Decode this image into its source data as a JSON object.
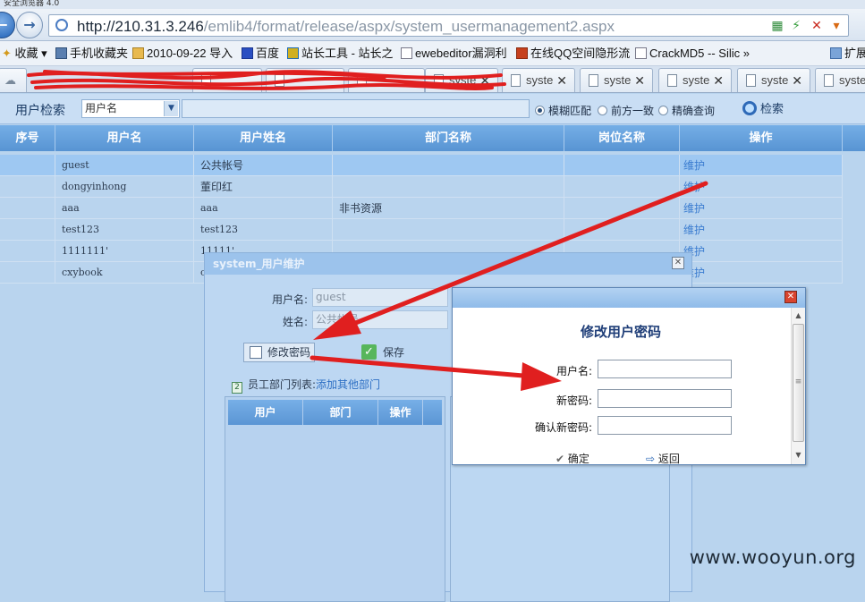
{
  "browser": {
    "title_partial": "安全浏览器 4.0",
    "url_host": "http://210.31.3.246",
    "url_path": "/emlib4/format/release/aspx/system_usermanagement2.aspx",
    "bookmarks": [
      {
        "label": "收藏"
      },
      {
        "label": "手机收藏夹"
      },
      {
        "label": "2010-09-22 导入"
      },
      {
        "label": "百度"
      },
      {
        "label": "站长工具 - 站长之"
      },
      {
        "label": "ewebeditor漏洞利"
      },
      {
        "label": "在线QQ空间隐形流"
      },
      {
        "label": "CrackMD5 -- Silic"
      },
      {
        "label": "扩展"
      }
    ],
    "tabs": [
      {
        "label": "syste"
      },
      {
        "label": "syste"
      },
      {
        "label": "syste"
      },
      {
        "label": "syste"
      },
      {
        "label": "syste"
      },
      {
        "label": "syste"
      }
    ]
  },
  "search": {
    "label": "用户检索",
    "field": "用户名",
    "mode_fuzzy": "模糊匹配",
    "mode_prefix": "前方一致",
    "mode_exact": "精确查询",
    "button": "检索"
  },
  "grid": {
    "columns": [
      "序号",
      "用户名",
      "用户姓名",
      "部门名称",
      "岗位名称",
      "操作"
    ],
    "rows": [
      {
        "username": "guest",
        "name": "公共帐号",
        "dept": "",
        "post": "",
        "action": "维护"
      },
      {
        "username": "dongyinhong",
        "name": "董印红",
        "dept": "",
        "post": "",
        "action": "维护"
      },
      {
        "username": "aaa",
        "name": "aaa",
        "dept": "非书资源",
        "post": "",
        "action": "维护"
      },
      {
        "username": "test123",
        "name": "test123",
        "dept": "",
        "post": "",
        "action": "维护"
      },
      {
        "username": "1111111'",
        "name": "11111'",
        "dept": "",
        "post": "",
        "action": "维护"
      },
      {
        "username": "cxybook",
        "name": "c",
        "dept": "",
        "post": "",
        "action": "维护"
      }
    ]
  },
  "maint_dialog": {
    "title": "system_用户维护",
    "username_label": "用户名:",
    "username_value": "guest",
    "name_label": "姓名:",
    "name_value": "公共帐号",
    "change_password_button": "修改密码",
    "save_button": "保存",
    "dept_list_label": "员工部门列表:",
    "add_dept_link": "添加其他部门",
    "dept_columns": [
      "用户",
      "部门",
      "操作"
    ]
  },
  "pwd_dialog": {
    "heading": "修改用户密码",
    "username_label": "用户名:",
    "new_password_label": "新密码:",
    "confirm_password_label": "确认新密码:",
    "ok_button": "确定",
    "back_button": "返回"
  },
  "watermark": "www.wooyun.org",
  "colors": {
    "header_blue": "#5894d3",
    "selected_row": "#9ec8f2",
    "link": "#3a7cd0",
    "annotation_red": "#e01f1f"
  }
}
